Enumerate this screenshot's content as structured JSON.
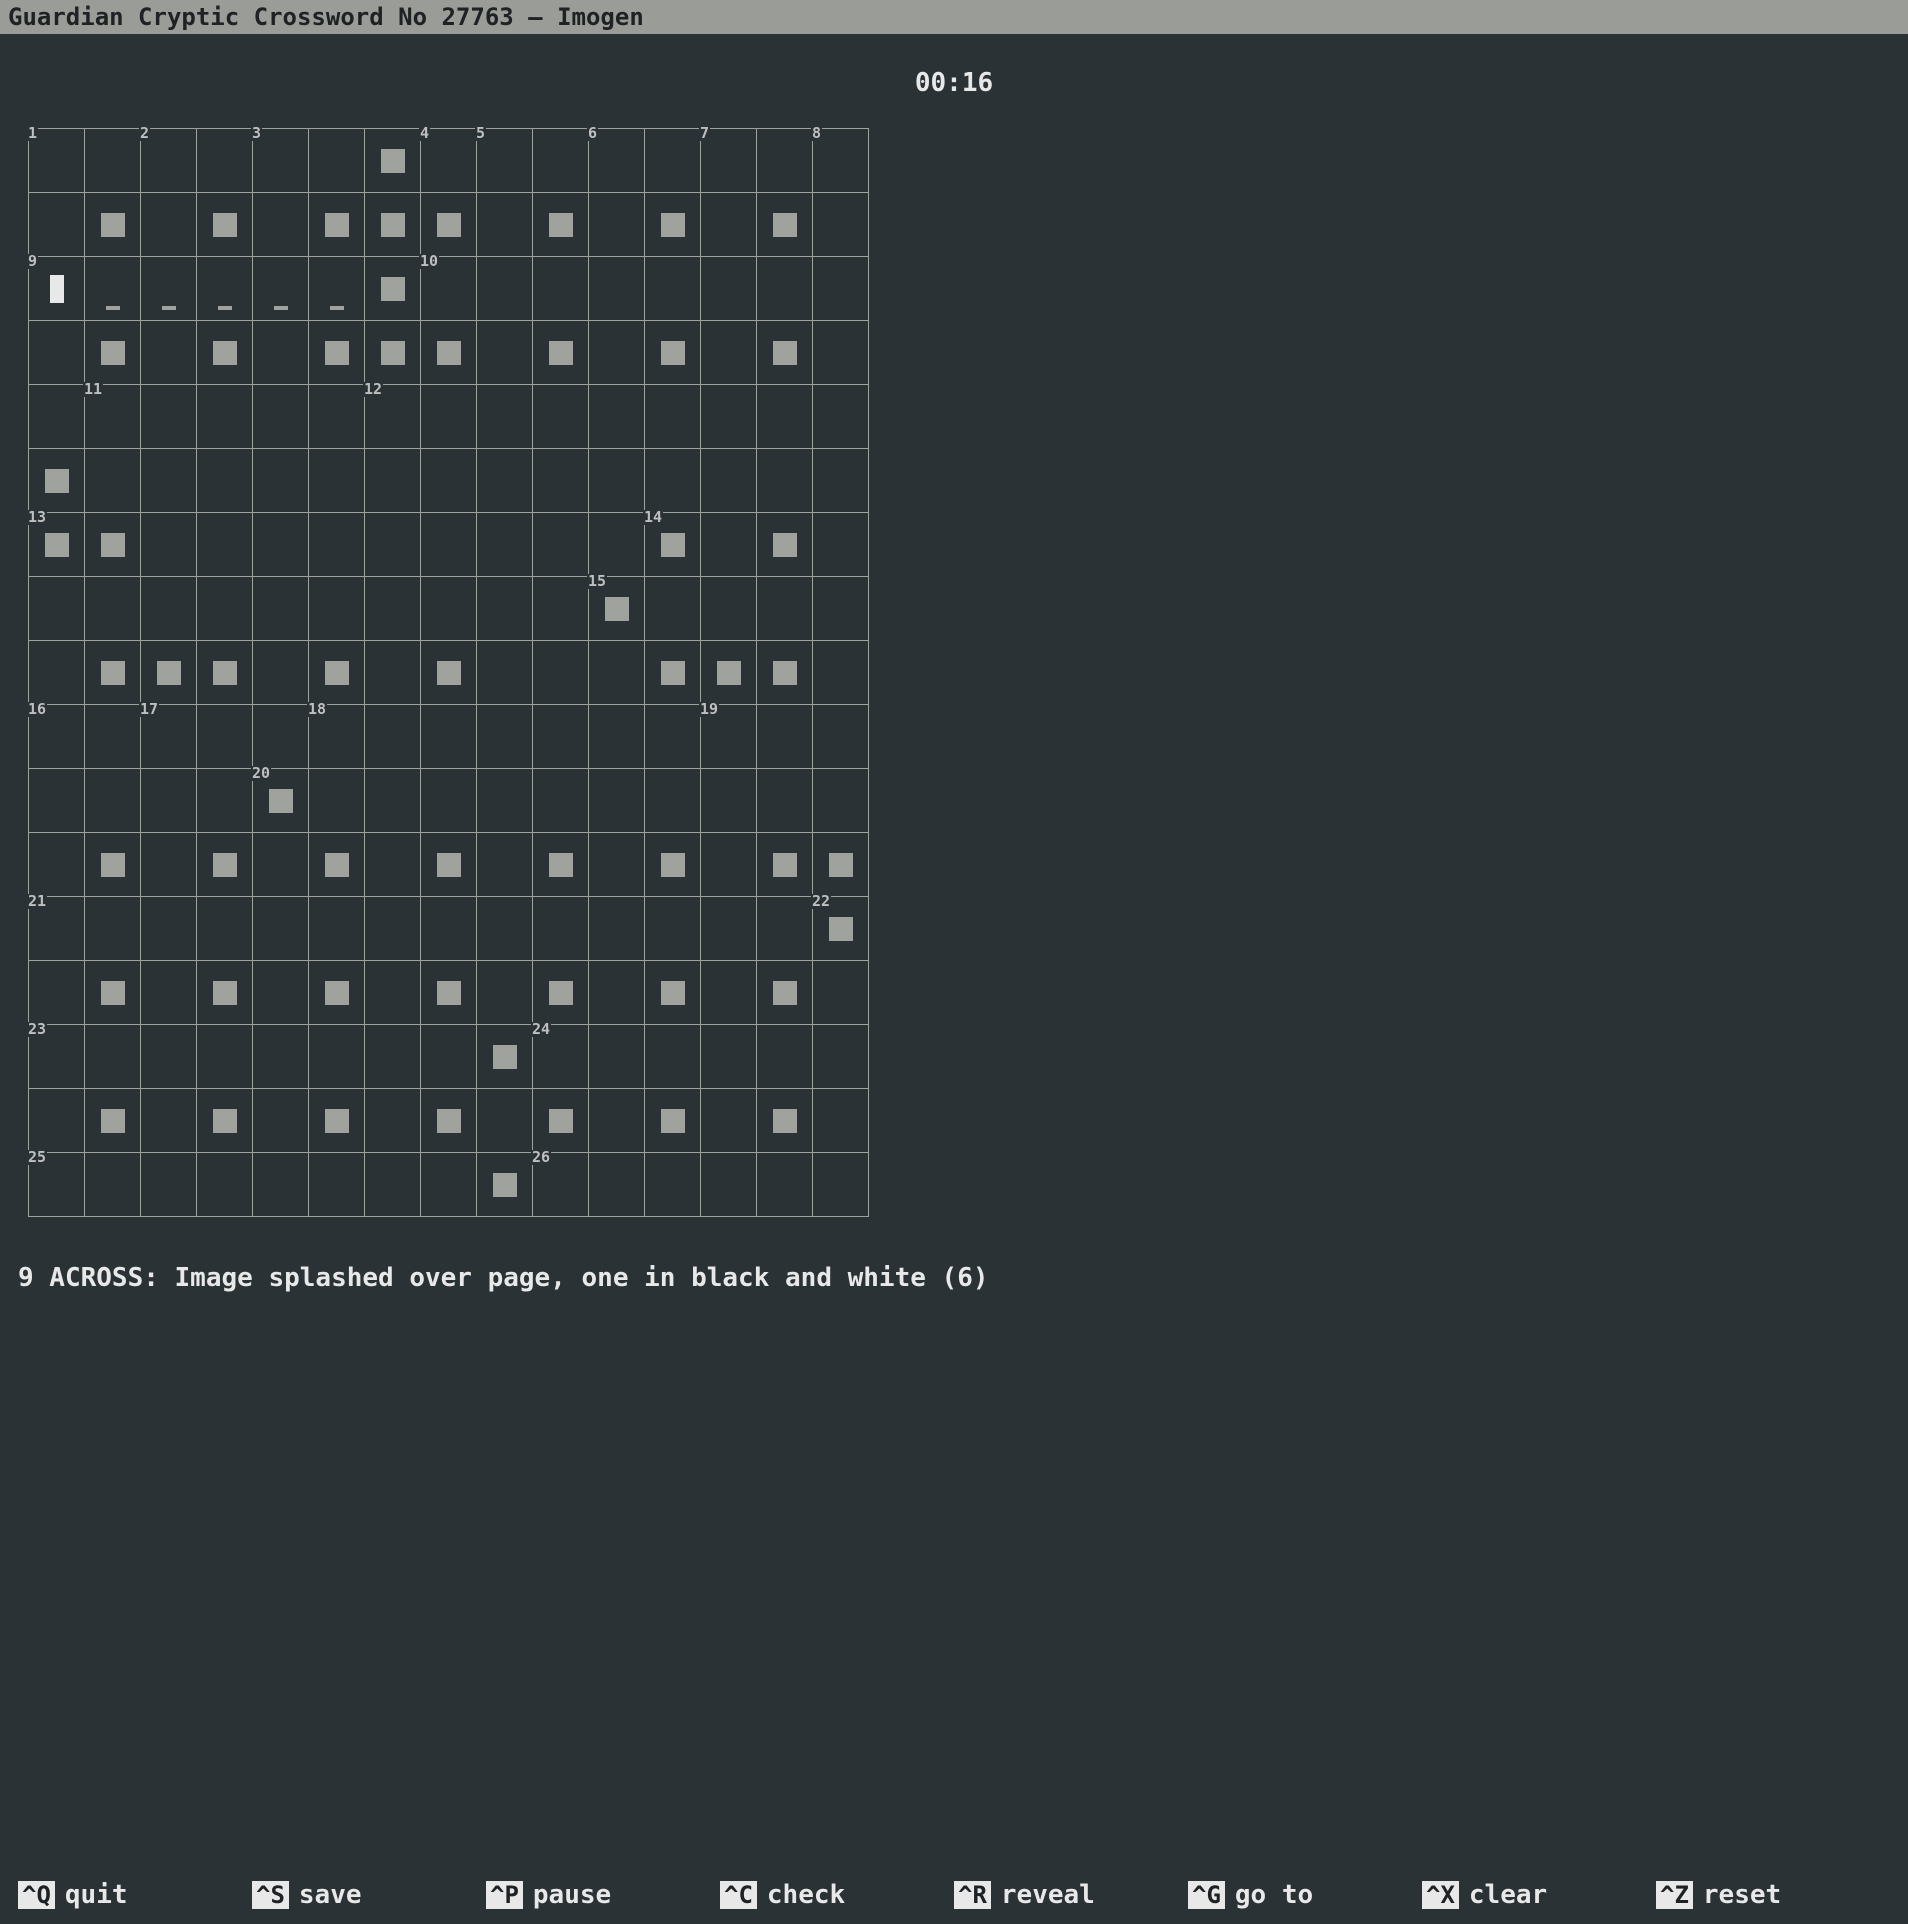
{
  "title": "Guardian Cryptic Crossword No 27763 — Imogen",
  "timer": "00:16",
  "clue": "9 ACROSS: Image splashed over page, one in black and white (6)",
  "grid": {
    "rows": 15,
    "cols": 15,
    "numbers": {
      "0,0": "1",
      "0,2": "2",
      "0,4": "3",
      "0,7": "4",
      "0,8": "5",
      "0,10": "6",
      "0,12": "7",
      "0,14": "8",
      "2,0": "9",
      "2,7": "10",
      "4,1": "11",
      "4,6": "12",
      "6,0": "13",
      "6,11": "14",
      "7,10": "15",
      "9,0": "16",
      "9,2": "17",
      "9,5": "18",
      "9,12": "19",
      "10,4": "20",
      "12,0": "21",
      "12,14": "22",
      "14,0": "23",
      "14,9": "24",
      "16,0": "25",
      "16,9": "26"
    },
    "blocks": [
      [
        0,
        6
      ],
      [
        1,
        1
      ],
      [
        1,
        3
      ],
      [
        1,
        5
      ],
      [
        1,
        6
      ],
      [
        1,
        7
      ],
      [
        1,
        9
      ],
      [
        1,
        11
      ],
      [
        1,
        13
      ],
      [
        2,
        6
      ],
      [
        3,
        1
      ],
      [
        3,
        3
      ],
      [
        3,
        5
      ],
      [
        3,
        6
      ],
      [
        3,
        7
      ],
      [
        3,
        9
      ],
      [
        3,
        11
      ],
      [
        3,
        13
      ],
      [
        5,
        0
      ],
      [
        6,
        0
      ],
      [
        6,
        1
      ],
      [
        6,
        11
      ],
      [
        6,
        13
      ],
      [
        7,
        10
      ],
      [
        8,
        1
      ],
      [
        8,
        2
      ],
      [
        8,
        3
      ],
      [
        8,
        5
      ],
      [
        8,
        7
      ],
      [
        8,
        11
      ],
      [
        8,
        12
      ],
      [
        8,
        13
      ],
      [
        10,
        4
      ],
      [
        11,
        1
      ],
      [
        11,
        3
      ],
      [
        11,
        5
      ],
      [
        11,
        7
      ],
      [
        11,
        9
      ],
      [
        11,
        11
      ],
      [
        11,
        13
      ],
      [
        11,
        14
      ],
      [
        12,
        14
      ],
      [
        13,
        1
      ],
      [
        13,
        3
      ],
      [
        13,
        5
      ],
      [
        13,
        7
      ],
      [
        13,
        9
      ],
      [
        13,
        11
      ],
      [
        13,
        13
      ],
      [
        14,
        8
      ],
      [
        15,
        1
      ],
      [
        15,
        3
      ],
      [
        15,
        5
      ],
      [
        15,
        7
      ],
      [
        15,
        9
      ],
      [
        15,
        11
      ],
      [
        15,
        13
      ],
      [
        16,
        8
      ]
    ],
    "cursor": [
      2,
      0
    ],
    "markers": [
      [
        2,
        1
      ],
      [
        2,
        2
      ],
      [
        2,
        3
      ],
      [
        2,
        4
      ],
      [
        2,
        5
      ]
    ]
  },
  "footer": [
    {
      "key": "^Q",
      "label": "quit"
    },
    {
      "key": "^S",
      "label": "save"
    },
    {
      "key": "^P",
      "label": "pause"
    },
    {
      "key": "^C",
      "label": "check"
    },
    {
      "key": "^R",
      "label": "reveal"
    },
    {
      "key": "^G",
      "label": "go to"
    },
    {
      "key": "^X",
      "label": "clear"
    },
    {
      "key": "^Z",
      "label": "reset"
    }
  ]
}
